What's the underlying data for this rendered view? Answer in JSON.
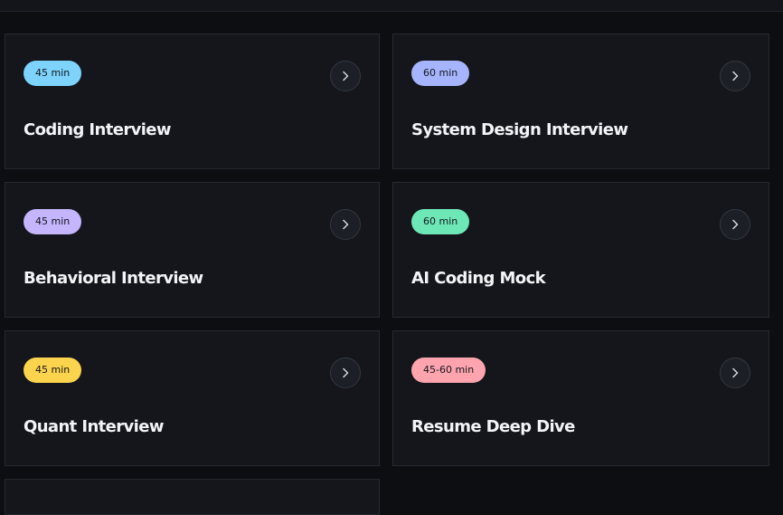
{
  "cards": [
    {
      "duration": "45 min",
      "title": "Coding Interview",
      "badge_color": "#7dd3fc"
    },
    {
      "duration": "60 min",
      "title": "System Design Interview",
      "badge_color": "#a5b4fc"
    },
    {
      "duration": "45 min",
      "title": "Behavioral Interview",
      "badge_color": "#c4b5fd"
    },
    {
      "duration": "60 min",
      "title": "AI Coding Mock",
      "badge_color": "#6ee7b7"
    },
    {
      "duration": "45 min",
      "title": "Quant Interview",
      "badge_color": "#fcd34d"
    },
    {
      "duration": "45-60 min",
      "title": "Resume Deep Dive",
      "badge_color": "#fda4af"
    }
  ],
  "icons": {
    "arrow": "chevron-right-icon"
  }
}
